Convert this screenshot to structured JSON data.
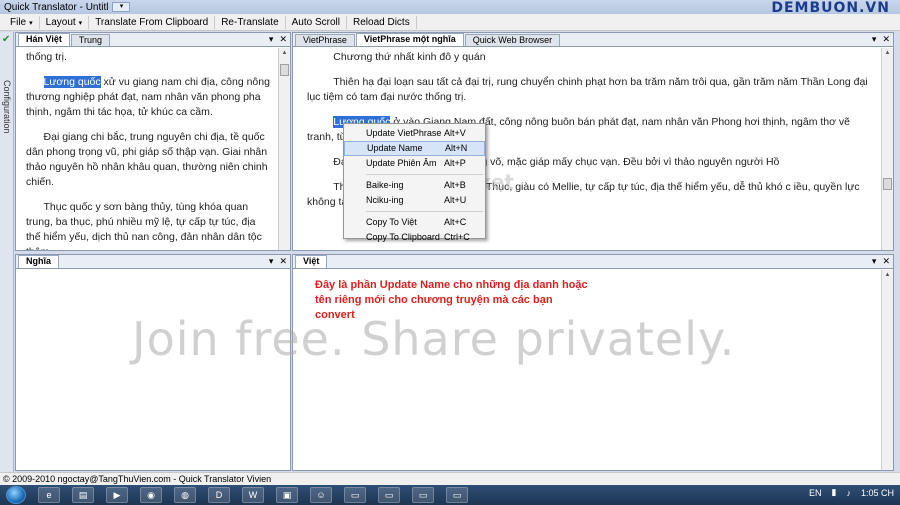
{
  "window": {
    "title": "Quick Translator - Untitl",
    "brand_watermark": "DEMBUON.VN"
  },
  "menu": [
    {
      "label": "File",
      "caret": "▾"
    },
    {
      "label": "Layout",
      "caret": "▾"
    },
    {
      "label": "Translate From Clipboard",
      "caret": ""
    },
    {
      "label": "Re-Translate",
      "caret": ""
    },
    {
      "label": "Auto Scroll",
      "caret": ""
    },
    {
      "label": "Reload Dicts",
      "caret": ""
    }
  ],
  "side_strip": {
    "label": "Configuration"
  },
  "top_left": {
    "tabs": [
      "Hán Việt",
      "Trung"
    ],
    "active_tab": "Hán Việt",
    "paragraphs": [
      {
        "before": "thống trị.",
        "highlight": "",
        "after": ""
      },
      {
        "before": "",
        "highlight": "Lương quốc",
        "after": " xử vu giang nam chi địa, công nông thương nghiệp phát đạt, nam nhân văn phong pha thịnh, ngâm thi tác họa, tử khúc ca cầm."
      },
      {
        "before": "Đại giang chi bắc, trung nguyên chi địa, tề quốc dân phong trọng vũ, phi giáp số thập vạn. Giai nhân thảo nguyên hồ nhân khâu quan, thường niên chinh chiến.",
        "highlight": "",
        "after": ""
      },
      {
        "before": "Thục quốc y sơn bàng thủy, tùng khóa quan trung, ba thục, phú nhiều mỹ lệ, tự cấp tự túc, địa thế hiểm yếu, dịch thủ nan công, đản nhân dân tộc thậm",
        "highlight": "",
        "after": ""
      }
    ]
  },
  "top_right": {
    "tabs": [
      "VietPhrase",
      "VietPhrase một nghĩa",
      "Quick Web Browser"
    ],
    "active_tab": "VietPhrase một nghĩa",
    "paragraphs": [
      {
        "before": "Chương thứ nhất kinh đô y quán",
        "highlight": "",
        "after": ""
      },
      {
        "before": "Thiên hạ đại loạn sau tất cả đại trị, rung chuyển chinh phạt hơn ba trăm năm trôi qua, gần trăm năm Thần Long đại lục tiệm có tam đại nước thống trị.",
        "highlight": "",
        "after": ""
      },
      {
        "before": "",
        "highlight": "Lương quốc",
        "after": " ở vào Giang Nam đất, công nông buôn bán phát đạt, nam nhân văn Phong hơi thịnh, ngâm thơ vẽ tranh, từ khúc ca C"
      },
      {
        "before": "Đạ                                     đất, Tề quốc dân phong trọng võ, mặc giáp mấy chục vạn. Đều bởi vì thảo nguyên người Hồ",
        "highlight": "",
        "after": ""
      },
      {
        "before": "Th                                     ng nhảy qua Quan Trung, Ba Thục, giàu có Mellie, tự cấp tự túc, địa thế hiểm yếu, dễ thủ khó c                                     iều, quyền lực không tập trung.",
        "highlight": "",
        "after": ""
      }
    ]
  },
  "context_menu": {
    "items": [
      {
        "label": "Update VietPhrase",
        "shortcut": "Alt+V"
      },
      {
        "label": "Update Name",
        "shortcut": "Alt+N"
      },
      {
        "label": "Update Phiên Âm",
        "shortcut": "Alt+P"
      },
      {
        "label": "Baike-ing",
        "shortcut": "Alt+B"
      },
      {
        "label": "Nciku-ing",
        "shortcut": "Alt+U"
      },
      {
        "label": "Copy To Việt",
        "shortcut": "Alt+C"
      },
      {
        "label": "Copy To Clipboard",
        "shortcut": "Ctrl+C"
      }
    ],
    "selected": "Update Name"
  },
  "bottom_left": {
    "tabs": [
      "Nghĩa"
    ],
    "active_tab": "Nghĩa"
  },
  "bottom_right": {
    "tabs": [
      "Việt"
    ],
    "active_tab": "Việt",
    "note_lines": [
      "Đây là phần Update Name cho những địa danh hoặc",
      "tên riêng mới cho chương truyện mà các bạn",
      "convert"
    ]
  },
  "tab_controls": {
    "pin": "▾",
    "close": "✕"
  },
  "status": {
    "text": "© 2009-2010 ngoctay@TangThuVien.com - Quick Translator Vivien"
  },
  "overlay_watermarks": {
    "photobucket": "photobucket",
    "join": "Join free. Share privately."
  },
  "taskbar": {
    "lang": "EN",
    "time": "1:05 CH",
    "apps": [
      "IE",
      "Folder",
      "Player",
      "Chrome",
      "Firefox",
      "D",
      "Word",
      "App",
      "Emoji",
      "Window",
      "Window",
      "Window",
      "Window",
      "Window"
    ]
  },
  "colors": {
    "highlight": "#2f6fd6",
    "note_red": "#e02020"
  }
}
